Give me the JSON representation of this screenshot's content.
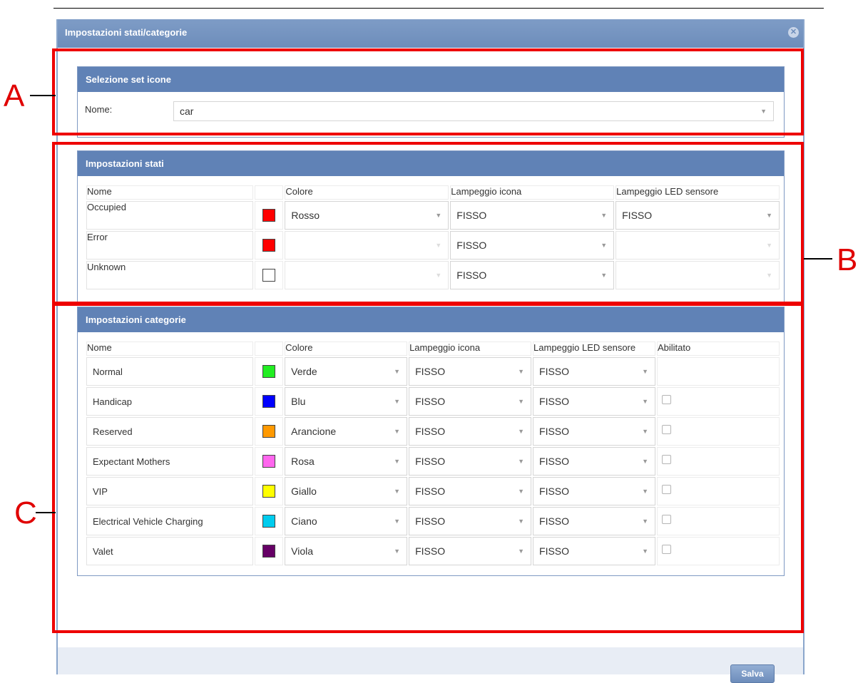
{
  "dialog": {
    "title": "Impostazioni stati/categorie",
    "close_icon": "close-circle-icon",
    "save_label": "Salva"
  },
  "icon_set": {
    "header": "Selezione set icone",
    "name_label": "Nome:",
    "name_value": "car"
  },
  "states": {
    "header": "Impostazioni stati",
    "columns": [
      "Nome",
      "",
      "Colore",
      "Lampeggio icona",
      "Lampeggio LED sensore"
    ],
    "rows": [
      {
        "name": "Occupied",
        "color_hex": "#ff0000",
        "color": "Rosso",
        "icon_blink": "FISSO",
        "led_blink": "FISSO"
      },
      {
        "name": "Error",
        "color_hex": "#ff0000",
        "color": "",
        "icon_blink": "FISSO",
        "led_blink": ""
      },
      {
        "name": "Unknown",
        "color_hex": "#ffffff",
        "color": "",
        "icon_blink": "FISSO",
        "led_blink": ""
      }
    ]
  },
  "categories": {
    "header": "Impostazioni categorie",
    "columns": [
      "Nome",
      "",
      "Colore",
      "Lampeggio icona",
      "Lampeggio LED sensore",
      "Abilitato"
    ],
    "rows": [
      {
        "name": "Normal",
        "color_hex": "#22ee22",
        "color": "Verde",
        "icon_blink": "FISSO",
        "led_blink": "FISSO",
        "enabled": null
      },
      {
        "name": "Handicap",
        "color_hex": "#0000ff",
        "color": "Blu",
        "icon_blink": "FISSO",
        "led_blink": "FISSO",
        "enabled": false
      },
      {
        "name": "Reserved",
        "color_hex": "#ff9900",
        "color": "Arancione",
        "icon_blink": "FISSO",
        "led_blink": "FISSO",
        "enabled": false
      },
      {
        "name": "Expectant Mothers",
        "color_hex": "#ff66ee",
        "color": "Rosa",
        "icon_blink": "FISSO",
        "led_blink": "FISSO",
        "enabled": false
      },
      {
        "name": "VIP",
        "color_hex": "#ffff00",
        "color": "Giallo",
        "icon_blink": "FISSO",
        "led_blink": "FISSO",
        "enabled": false
      },
      {
        "name": "Electrical Vehicle Charging",
        "color_hex": "#00ccee",
        "color": "Ciano",
        "icon_blink": "FISSO",
        "led_blink": "FISSO",
        "enabled": false
      },
      {
        "name": "Valet",
        "color_hex": "#660066",
        "color": "Viola",
        "icon_blink": "FISSO",
        "led_blink": "FISSO",
        "enabled": false
      }
    ]
  },
  "annotations": {
    "labels": [
      "A",
      "B",
      "C"
    ],
    "color": "#ee0000"
  }
}
